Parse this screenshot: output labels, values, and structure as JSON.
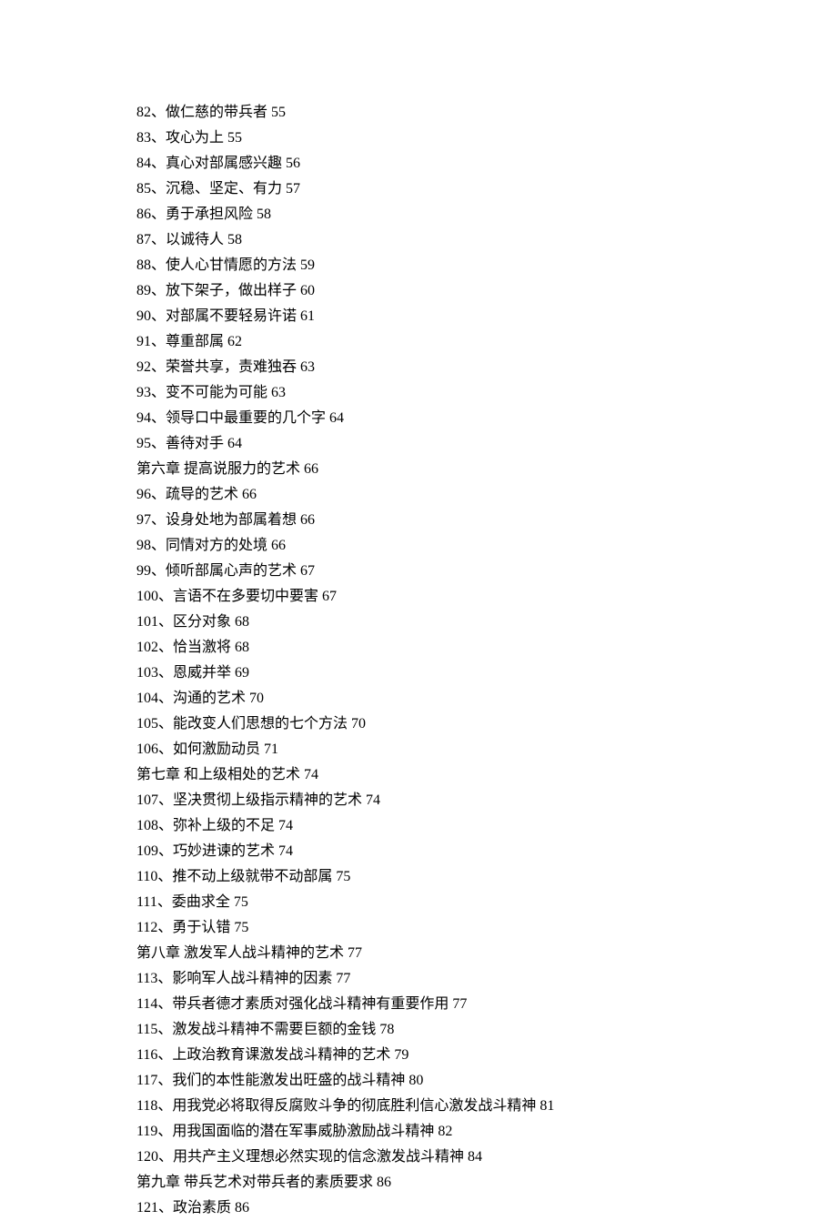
{
  "toc": [
    {
      "text": "82、做仁慈的带兵者 55"
    },
    {
      "text": "83、攻心为上 55"
    },
    {
      "text": "84、真心对部属感兴趣 56"
    },
    {
      "text": "85、沉稳、坚定、有力 57"
    },
    {
      "text": "86、勇于承担风险 58"
    },
    {
      "text": "87、以诚待人 58"
    },
    {
      "text": "88、使人心甘情愿的方法 59"
    },
    {
      "text": "89、放下架子，做出样子 60"
    },
    {
      "text": "90、对部属不要轻易许诺 61"
    },
    {
      "text": "91、尊重部属 62"
    },
    {
      "text": "92、荣誉共享，责难独吞 63"
    },
    {
      "text": "93、变不可能为可能 63"
    },
    {
      "text": "94、领导口中最重要的几个字 64"
    },
    {
      "text": "95、善待对手 64"
    },
    {
      "text": "第六章 提高说服力的艺术 66"
    },
    {
      "text": "96、疏导的艺术 66"
    },
    {
      "text": "97、设身处地为部属着想 66"
    },
    {
      "text": "98、同情对方的处境 66"
    },
    {
      "text": "99、倾听部属心声的艺术 67"
    },
    {
      "text": "100、言语不在多要切中要害 67"
    },
    {
      "text": "101、区分对象 68"
    },
    {
      "text": "102、恰当激将 68"
    },
    {
      "text": "103、恩威并举 69"
    },
    {
      "text": "104、沟通的艺术 70"
    },
    {
      "text": "105、能改变人们思想的七个方法 70"
    },
    {
      "text": "106、如何激励动员 71"
    },
    {
      "text": "第七章 和上级相处的艺术 74"
    },
    {
      "text": "107、坚决贯彻上级指示精神的艺术 74"
    },
    {
      "text": "108、弥补上级的不足 74"
    },
    {
      "text": "109、巧妙进谏的艺术 74"
    },
    {
      "text": "110、推不动上级就带不动部属 75"
    },
    {
      "text": "111、委曲求全 75"
    },
    {
      "text": "112、勇于认错 75"
    },
    {
      "text": "第八章 激发军人战斗精神的艺术 77"
    },
    {
      "text": "113、影响军人战斗精神的因素 77"
    },
    {
      "text": "114、带兵者德才素质对强化战斗精神有重要作用 77"
    },
    {
      "text": "115、激发战斗精神不需要巨额的金钱 78"
    },
    {
      "text": "116、上政治教育课激发战斗精神的艺术 79"
    },
    {
      "text": "117、我们的本性能激发出旺盛的战斗精神 80"
    },
    {
      "text": "118、用我党必将取得反腐败斗争的彻底胜利信心激发战斗精神 81"
    },
    {
      "text": "119、用我国面临的潜在军事威胁激励战斗精神 82"
    },
    {
      "text": "120、用共产主义理想必然实现的信念激发战斗精神 84"
    },
    {
      "text": "第九章 带兵艺术对带兵者的素质要求 86"
    },
    {
      "text": "121、政治素质 86"
    }
  ]
}
